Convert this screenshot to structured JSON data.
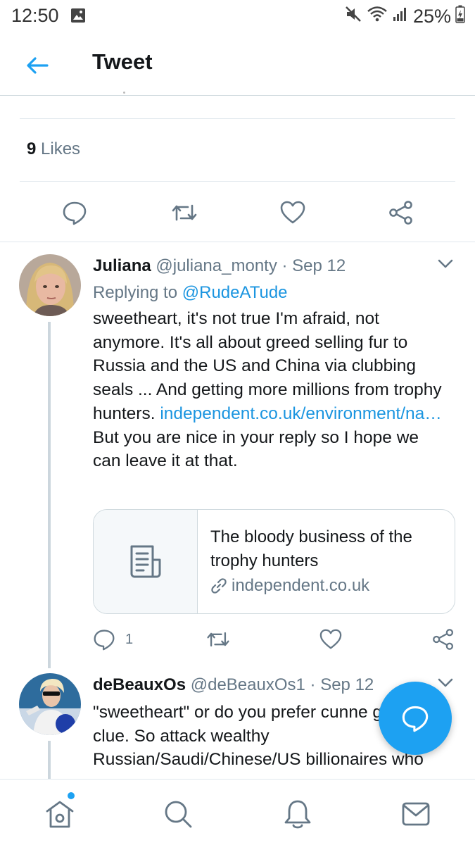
{
  "status_bar": {
    "time": "12:50",
    "battery": "25%",
    "icons": [
      "gallery-icon",
      "mute-icon",
      "wifi-icon",
      "signal-icon",
      "battery-charging-icon"
    ]
  },
  "header": {
    "title": "Tweet",
    "back_icon": "arrow-left-icon"
  },
  "stats": {
    "likes_count": "9",
    "likes_label": "Likes"
  },
  "main_actions": [
    "reply-icon",
    "retweet-icon",
    "like-icon",
    "share-icon"
  ],
  "replies": [
    {
      "name": "Juliana",
      "handle": "@juliana_monty",
      "separator": "·",
      "date": "Sep 12",
      "replying_prefix": "Replying to",
      "replying_to": "@RudeATude",
      "text_before_link": "sweetheart, it's not true I'm afraid, not anymore. It's all about greed selling fur to Russia and the US and China via clubbing seals ... And getting more millions from trophy hunters.",
      "link_text": "independent.co.uk/environment/na…",
      "text_after_link": "But you are nice in your reply so I hope we can leave it at that.",
      "card": {
        "title": "The bloody business of the trophy hunters",
        "domain": "independent.co.uk"
      },
      "reply_count": "1"
    },
    {
      "name": "deBeauxOs",
      "handle": "@deBeauxOs1",
      "separator": "·",
      "date": "Sep 12",
      "text": "\"sweetheart\" or do you prefer cunne get a clue. So attack wealthy Russian/Saudi/Chinese/US billionaires who"
    }
  ],
  "colors": {
    "accent": "#1da1f2",
    "link": "#1b95e0",
    "secondary_text": "#657786",
    "divider": "#e1e8ed"
  },
  "bottom_nav": [
    "home-icon",
    "search-icon",
    "notifications-icon",
    "messages-icon"
  ]
}
